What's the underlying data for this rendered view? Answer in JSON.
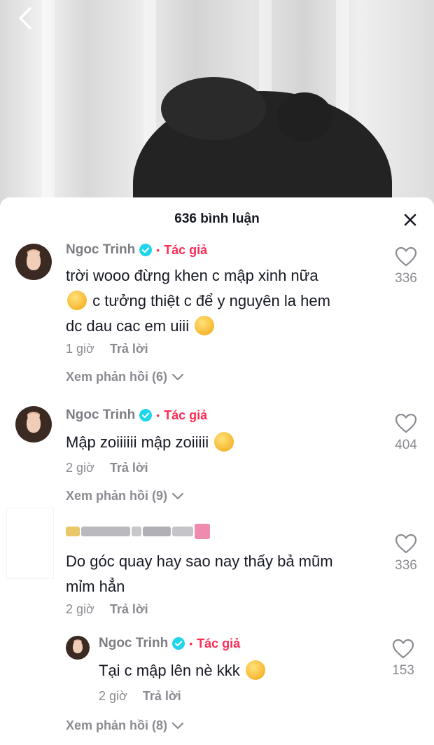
{
  "header": {
    "title": "636 bình luận"
  },
  "comments": [
    {
      "name": "Ngoc Trinh",
      "author_label": "Tác giả",
      "text_lines": [
        "trời wooo đừng khen c mập xinh nữa",
        "c tưởng thiệt c để y nguyên la hem",
        "dc dau cac em uiii"
      ],
      "time": "1 giờ",
      "reply": "Trả lời",
      "likes": "336",
      "view_replies": "Xem phản hồi (6)"
    },
    {
      "name": "Ngoc Trinh",
      "author_label": "Tác giả",
      "text_lines": [
        "Mập zoiiiiii mập zoiiiii"
      ],
      "time": "2 giờ",
      "reply": "Trả lời",
      "likes": "404",
      "view_replies": "Xem phản hồi (9)"
    },
    {
      "text_lines": [
        "Do góc quay hay sao nay thấy bả mũm",
        "mỉm hẳn"
      ],
      "time": "2 giờ",
      "reply": "Trả lời",
      "likes": "336"
    },
    {
      "name": "Ngoc Trinh",
      "author_label": "Tác giả",
      "text_lines": [
        "Tại c mập lên nè kkk"
      ],
      "time": "2 giờ",
      "reply": "Trả lời",
      "likes": "153",
      "view_replies": "Xem phản hồi (8)"
    }
  ],
  "colors": {
    "accent": "#fe2c55",
    "verified": "#20d5ec",
    "muted": "#8a8b91",
    "text": "#161823"
  },
  "icons": [
    "back-icon",
    "close-icon",
    "verified-icon",
    "heart-icon",
    "chevron-down-icon",
    "emoji-icon"
  ]
}
